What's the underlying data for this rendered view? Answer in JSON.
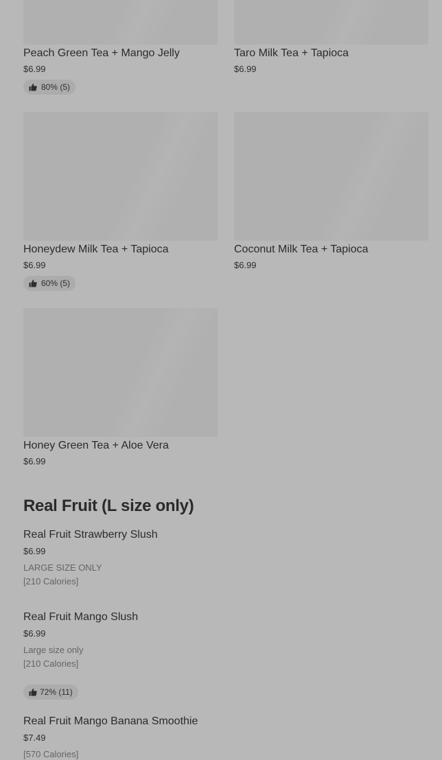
{
  "grid_items": [
    {
      "name": "Peach Green Tea + Mango Jelly",
      "price": "$6.99",
      "rating": "80% (5)"
    },
    {
      "name": "Taro Milk Tea + Tapioca",
      "price": "$6.99",
      "rating": ""
    },
    {
      "name": "Honeydew Milk Tea + Tapioca",
      "price": "$6.99",
      "rating": "60% (5)"
    },
    {
      "name": "Coconut Milk Tea + Tapioca",
      "price": "$6.99",
      "rating": ""
    },
    {
      "name": "Honey Green Tea + Aloe Vera",
      "price": "$6.99",
      "rating": ""
    }
  ],
  "section": {
    "title": "Real Fruit (L size only)",
    "items": [
      {
        "name": "Real Fruit Strawberry Slush",
        "price": "$6.99",
        "description": "LARGE SIZE ONLY",
        "calories": "[210 Calories]",
        "rating": ""
      },
      {
        "name": "Real Fruit Mango Slush",
        "price": "$6.99",
        "description": "Large size only",
        "calories": "[210 Calories]",
        "rating": "72% (11)"
      },
      {
        "name": "Real Fruit Mango Banana Smoothie",
        "price": "$7.49",
        "description": "",
        "calories": "[570 Calories]",
        "rating": ""
      }
    ]
  },
  "icons": {
    "rating": "thumbs-up-icon"
  },
  "colors": {
    "background": "#b8b8b8",
    "image_placeholder": "#b0b0b0",
    "rating_pill": "#acacac",
    "text": "#2b2b2b",
    "muted_text": "#646464"
  }
}
